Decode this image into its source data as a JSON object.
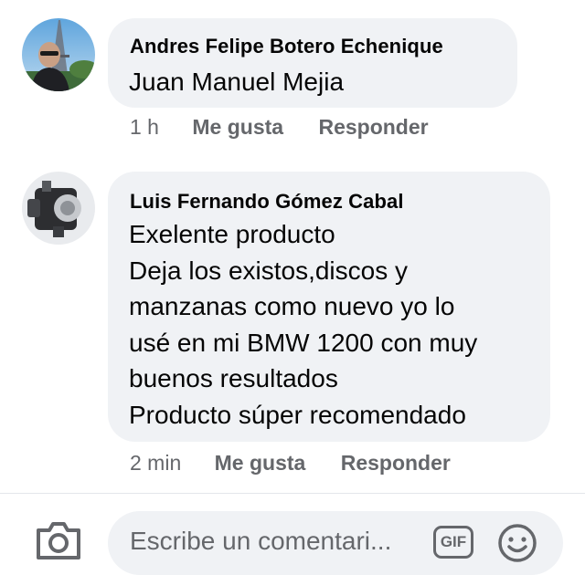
{
  "comments": [
    {
      "author": "Andres Felipe Botero Echenique",
      "text": "Juan Manuel Mejia",
      "time": "1 h",
      "like_label": "Me gusta",
      "reply_label": "Responder"
    },
    {
      "author": "Luis Fernando Gómez Cabal",
      "lines": [
        "Exelente producto",
        "Deja los existos,discos y",
        "manzanas como nuevo yo lo",
        "usé en mi BMW 1200 con muy",
        "buenos resultados",
        "Producto súper recomendado"
      ],
      "time": "2 min",
      "like_label": "Me gusta",
      "reply_label": "Responder"
    }
  ],
  "composer": {
    "placeholder": "Escribe un comentari...",
    "gif_label": "GIF",
    "camera_icon": "camera-icon",
    "emoji_icon": "emoji-icon"
  },
  "colors": {
    "bubble": "#f0f2f5",
    "meta_text": "#65676b",
    "primary_text": "#050505"
  }
}
